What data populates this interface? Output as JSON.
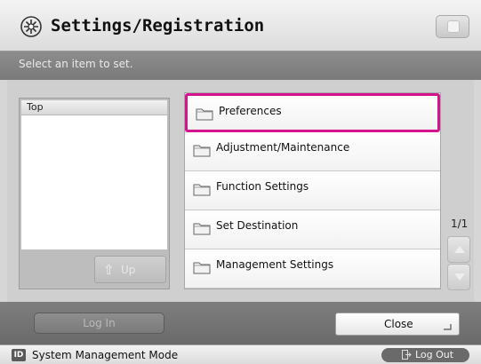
{
  "header": {
    "title": "Settings/Registration",
    "icon": "settings-gear-icon",
    "right_icon": "cube-icon"
  },
  "instruction": "Select an item to set.",
  "tree": {
    "header": "Top",
    "up_label": "Up",
    "up_icon": "up-arrow-icon"
  },
  "menu": {
    "items": [
      {
        "label": "Preferences",
        "selected": true
      },
      {
        "label": "Adjustment/Maintenance",
        "selected": false
      },
      {
        "label": "Function Settings",
        "selected": false
      },
      {
        "label": "Set Destination",
        "selected": false
      },
      {
        "label": "Management Settings",
        "selected": false
      }
    ],
    "item_icon": "folder-icon"
  },
  "pager": {
    "text": "1/1"
  },
  "footer": {
    "login_label": "Log In",
    "close_label": "Close"
  },
  "status": {
    "id_badge": "ID",
    "mode_text": "System Management Mode",
    "logout_label": "Log Out"
  },
  "colors": {
    "selection": "#d4138d",
    "instruction_bg": "#7f7f7f",
    "footer_bg": "#707070"
  }
}
